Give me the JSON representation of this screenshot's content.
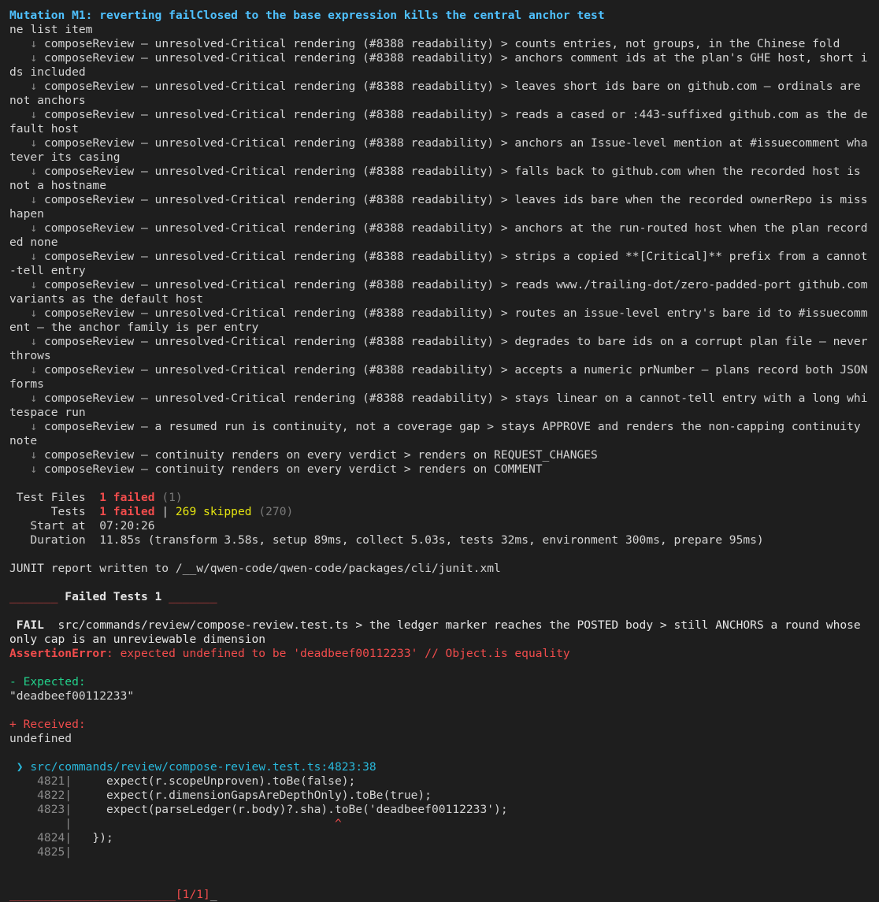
{
  "header": {
    "title": "Mutation M1: reverting failClosed to the base expression kills the central anchor test",
    "continuation": "ne list item"
  },
  "skip_glyph": "↓",
  "skipped_tests": [
    "composeReview — unresolved-Critical rendering (#8388 readability) > counts entries, not groups, in the Chinese fold",
    "composeReview — unresolved-Critical rendering (#8388 readability) > anchors comment ids at the plan's GHE host, short ids included",
    "composeReview — unresolved-Critical rendering (#8388 readability) > leaves short ids bare on github.com — ordinals are not anchors",
    "composeReview — unresolved-Critical rendering (#8388 readability) > reads a cased or :443-suffixed github.com as the default host",
    "composeReview — unresolved-Critical rendering (#8388 readability) > anchors an Issue-level mention at #issuecomment whatever its casing",
    "composeReview — unresolved-Critical rendering (#8388 readability) > falls back to github.com when the recorded host is not a hostname",
    "composeReview — unresolved-Critical rendering (#8388 readability) > leaves ids bare when the recorded ownerRepo is misshapen",
    "composeReview — unresolved-Critical rendering (#8388 readability) > anchors at the run-routed host when the plan recorded none",
    "composeReview — unresolved-Critical rendering (#8388 readability) > strips a copied **[Critical]** prefix from a cannot-tell entry",
    "composeReview — unresolved-Critical rendering (#8388 readability) > reads www./trailing-dot/zero-padded-port github.com variants as the default host",
    "composeReview — unresolved-Critical rendering (#8388 readability) > routes an issue-level entry's bare id to #issuecomment — the anchor family is per entry",
    "composeReview — unresolved-Critical rendering (#8388 readability) > degrades to bare ids on a corrupt plan file — never throws",
    "composeReview — unresolved-Critical rendering (#8388 readability) > accepts a numeric prNumber — plans record both JSON forms",
    "composeReview — unresolved-Critical rendering (#8388 readability) > stays linear on a cannot-tell entry with a long whitespace run",
    "composeReview — a resumed run is continuity, not a coverage gap > stays APPROVE and renders the non-capping continuity note",
    "composeReview — continuity renders on every verdict > renders on REQUEST_CHANGES",
    "composeReview — continuity renders on every verdict > renders on COMMENT"
  ],
  "summary": {
    "test_files_label": " Test Files  ",
    "test_files_failed": "1 failed",
    "test_files_total": " (1)",
    "tests_label": "      Tests  ",
    "tests_failed": "1 failed",
    "tests_sep": " | ",
    "tests_skipped": "269 skipped",
    "tests_total": " (270)",
    "start_label": "   Start at  ",
    "start_value": "07:20:26",
    "duration_label": "   Duration  ",
    "duration_value": "11.85s (transform 3.58s, setup 89ms, collect 5.03s, tests 32ms, environment 300ms, prepare 95ms)"
  },
  "junit": "JUNIT report written to /__w/qwen-code/qwen-code/packages/cli/junit.xml",
  "failed_header": {
    "bar_left": "_______",
    "title": " Failed Tests 1 ",
    "bar_right": "_______"
  },
  "failure": {
    "badge": " FAIL ",
    "test_path": " src/commands/review/compose-review.test.ts > the ledger marker reaches the POSTED body > still ANCHORS a round whose only cap is an unreviewable dimension",
    "error_type": "AssertionError",
    "error_message": ": expected undefined to be 'deadbeef00112233' // Object.is equality",
    "expected_label": "- Expected:",
    "expected_value": "\"deadbeef00112233\"",
    "received_label": "+ Received:",
    "received_value": "undefined",
    "location_marker": " ❯ ",
    "location": "src/commands/review/compose-review.test.ts:4823:38"
  },
  "code_lines": [
    {
      "num": "    4821|",
      "code": "     expect(r.scopeUnproven).toBe(false);"
    },
    {
      "num": "    4822|",
      "code": "     expect(r.dimensionGapsAreDepthOnly).toBe(true);"
    },
    {
      "num": "    4823|",
      "code": "     expect(parseLedger(r.body)?.sha).toBe('deadbeef00112233');"
    },
    {
      "num": "        |",
      "code": "                                      ^"
    },
    {
      "num": "    4824|",
      "code": "   });"
    },
    {
      "num": "    4825|",
      "code": ""
    }
  ],
  "footer": {
    "bar": "________________________",
    "counter": "[1/1]",
    "tail": "_"
  },
  "colors": {
    "background": "#1e1e1e",
    "text": "#d4d4d4",
    "title": "#4fc1ff",
    "fail": "#f14c4c",
    "skipped": "#e5e510",
    "expected": "#23d18b",
    "link": "#29b8db"
  }
}
